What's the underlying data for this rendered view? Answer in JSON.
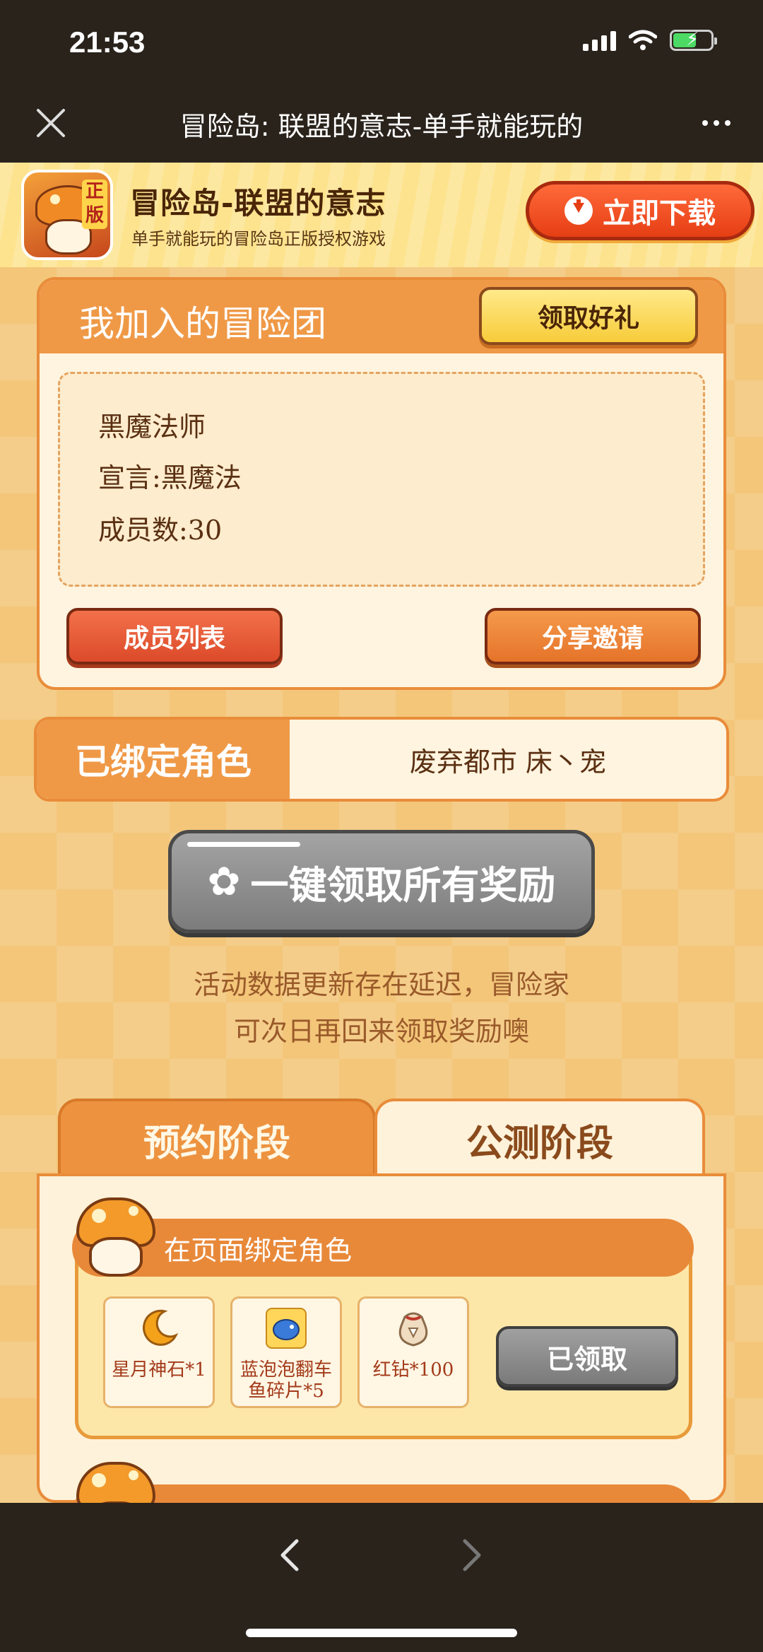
{
  "status_bar": {
    "time": "21:53"
  },
  "nav": {
    "title": "冒险岛: 联盟的意志-单手就能玩的"
  },
  "banner": {
    "game_title": "冒险岛-联盟的意志",
    "subtitle": "单手就能玩的冒险岛正版授权游戏",
    "icon_tag": "正版",
    "download_label": "立即下载"
  },
  "guild": {
    "title": "我加入的冒险团",
    "gift_label": "领取好礼",
    "name": "黑魔法师",
    "declaration": "宣言:黑魔法",
    "members": "成员数:30",
    "members_button": "成员列表",
    "share_button": "分享邀请"
  },
  "bound": {
    "label": "已绑定角色",
    "value": "废弃都市 床丶宠"
  },
  "claim_all_label": "一键领取所有奖励",
  "notice": {
    "line1": "活动数据更新存在延迟，冒险家",
    "line2": "可次日再回来领取奖励噢"
  },
  "tabs": [
    {
      "label": "预约阶段",
      "active": false
    },
    {
      "label": "公测阶段",
      "active": true
    }
  ],
  "task": {
    "title": "在页面绑定角色",
    "rewards": [
      {
        "label": "星月神石*1",
        "icon": "crescent-moon-icon"
      },
      {
        "label": "蓝泡泡翻车鱼碎片*5",
        "icon": "fish-icon"
      },
      {
        "label": "红钻*100",
        "icon": "bag-icon"
      }
    ],
    "claimed_label": "已领取"
  },
  "colors": {
    "accent": "#ef9947",
    "background": "#f3c67a",
    "dark_bar": "#2a231c"
  }
}
